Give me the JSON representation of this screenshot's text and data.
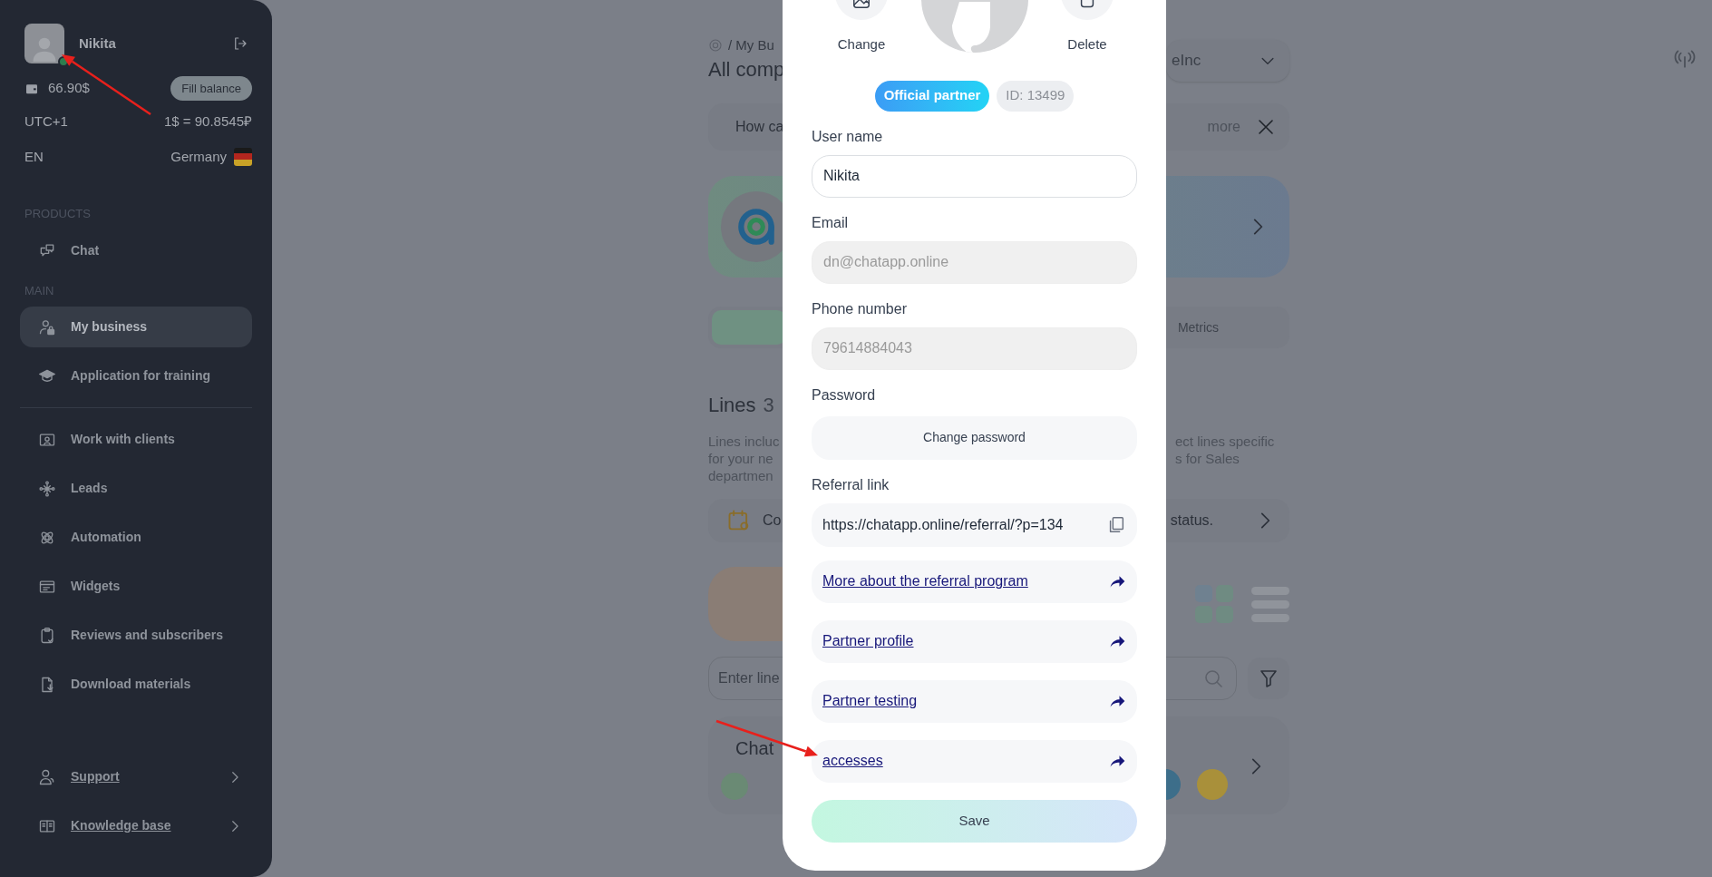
{
  "sidebar": {
    "user": {
      "name": "Nikita",
      "online": true
    },
    "balance": "66.90$",
    "fill_balance_button": "Fill balance",
    "timezone": "UTC+1",
    "rate": "1$ = 90.8545₽",
    "language": "EN",
    "country": "Germany",
    "sections": [
      {
        "heading": "PRODUCTS",
        "items": [
          {
            "label": "Chat",
            "selected": false
          }
        ]
      },
      {
        "heading": "MAIN",
        "items": [
          {
            "label": "My business",
            "selected": true
          },
          {
            "label": "Application for training",
            "selected": false
          }
        ]
      },
      {
        "items": [
          {
            "label": "Work with clients",
            "selected": false
          },
          {
            "label": "Leads",
            "selected": false
          },
          {
            "label": "Automation",
            "selected": false
          },
          {
            "label": "Widgets",
            "selected": false
          },
          {
            "label": "Reviews and subscribers",
            "selected": false
          },
          {
            "label": "Download materials",
            "selected": false
          }
        ]
      }
    ],
    "footer_links": [
      {
        "label": "Support"
      },
      {
        "label": "Knowledge base"
      }
    ]
  },
  "background_page": {
    "breadcrumb": "/ My Bu",
    "title": "All comp",
    "company_select": "eInc",
    "notice": {
      "text": "How ca",
      "more": "more"
    },
    "tabs": [
      {
        "selected": true
      },
      {
        "label": "Metrics",
        "selected": false
      }
    ],
    "lines": {
      "title": "Lines",
      "count": "3",
      "description_left": [
        "Lines incluc",
        "for your ne",
        "departmen"
      ],
      "description_right": [
        "ect lines specific",
        "s for Sales"
      ]
    },
    "setup_row": {
      "left": "Co",
      "right": "status."
    },
    "search": {
      "placeholder": "Enter line"
    },
    "line_card": {
      "title": "Chat"
    }
  },
  "profile_modal": {
    "change_label": "Change",
    "delete_label": "Delete",
    "badges": [
      {
        "kind": "partner",
        "text": "Official partner"
      },
      {
        "kind": "id",
        "text": "ID: 13499"
      }
    ],
    "fields": [
      {
        "kind": "input",
        "label": "User name",
        "value": "Nikita",
        "disabled": false
      },
      {
        "kind": "input",
        "label": "Email",
        "value": "dn@chatapp.online",
        "disabled": true
      },
      {
        "kind": "input",
        "label": "Phone number",
        "value": "79614884043",
        "disabled": true
      },
      {
        "kind": "button",
        "label": "Password",
        "value": "Change password"
      },
      {
        "kind": "copy",
        "label": "Referral link",
        "value": "https://chatapp.online/referral/?p=134"
      }
    ],
    "links": [
      {
        "label": "More about the referral program"
      },
      {
        "label": "Partner profile"
      },
      {
        "label": "Partner testing"
      },
      {
        "label": "accesses"
      }
    ],
    "save_button": "Save"
  }
}
